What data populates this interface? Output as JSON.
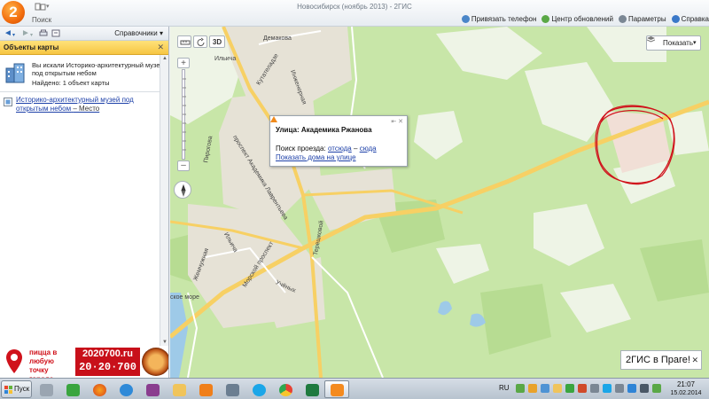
{
  "window": {
    "title": "Новосибирск (ноябрь 2013) - 2ГИС",
    "logo_text": "2",
    "search_tab": "",
    "search_label": "Поиск"
  },
  "toolbar": {
    "bind_phone": "Привязать телефон",
    "update_center": "Центр обновлений",
    "settings": "Параметры",
    "help": "Справка"
  },
  "left_panel": {
    "directories": "Справочники",
    "objects_header": "Объекты карты",
    "result_query": "Вы искали Историко-архитектурный музей под открытым небом",
    "result_found": "Найдено: 1 объект карты",
    "place_name": "Историко-архитектурный музей под открытым небом",
    "place_type": "– Место"
  },
  "ad": {
    "slogan": "пицца в любую точку города",
    "site": "2020700.ru",
    "phone": "20·20·700"
  },
  "map": {
    "mode_3d": "3D",
    "layers_label": "Показать",
    "streets": {
      "demakova": "Демакова",
      "ilkavilya": "Ильича",
      "kutateladze": "Кутателадзе",
      "inzhenernaya": "Инженерная",
      "lavrentyeva": "проспект Академика Лаврентьева",
      "pirogova": "Пирогова",
      "ilyicha": "Ильича",
      "zhemchuzhnaya": "Жемчужная",
      "morskoy": "Морской проспект",
      "tereshkovoy": "Терешковой",
      "uchenykh": "Учёных",
      "sea": "ское море"
    },
    "popup": {
      "street_label": "Улица:",
      "street_name": "Академика Ржанова",
      "route_label": "Поиск проезда:",
      "route_from": "отсюда",
      "route_sep": "–",
      "route_to": "сюда",
      "houses_link": "Показать дома на улице"
    },
    "prague_badge": "2ГИС в Праге!",
    "colors": {
      "forest": "#c8e6a8",
      "clearing": "#eef4e6",
      "urban": "#e6e2d6",
      "road": "#f7d064",
      "water": "#9ecae8",
      "annotation": "#d0101a"
    }
  },
  "taskbar": {
    "start": "Пуск",
    "language": "RU",
    "time": "21:07",
    "date": "15.02.2014"
  }
}
